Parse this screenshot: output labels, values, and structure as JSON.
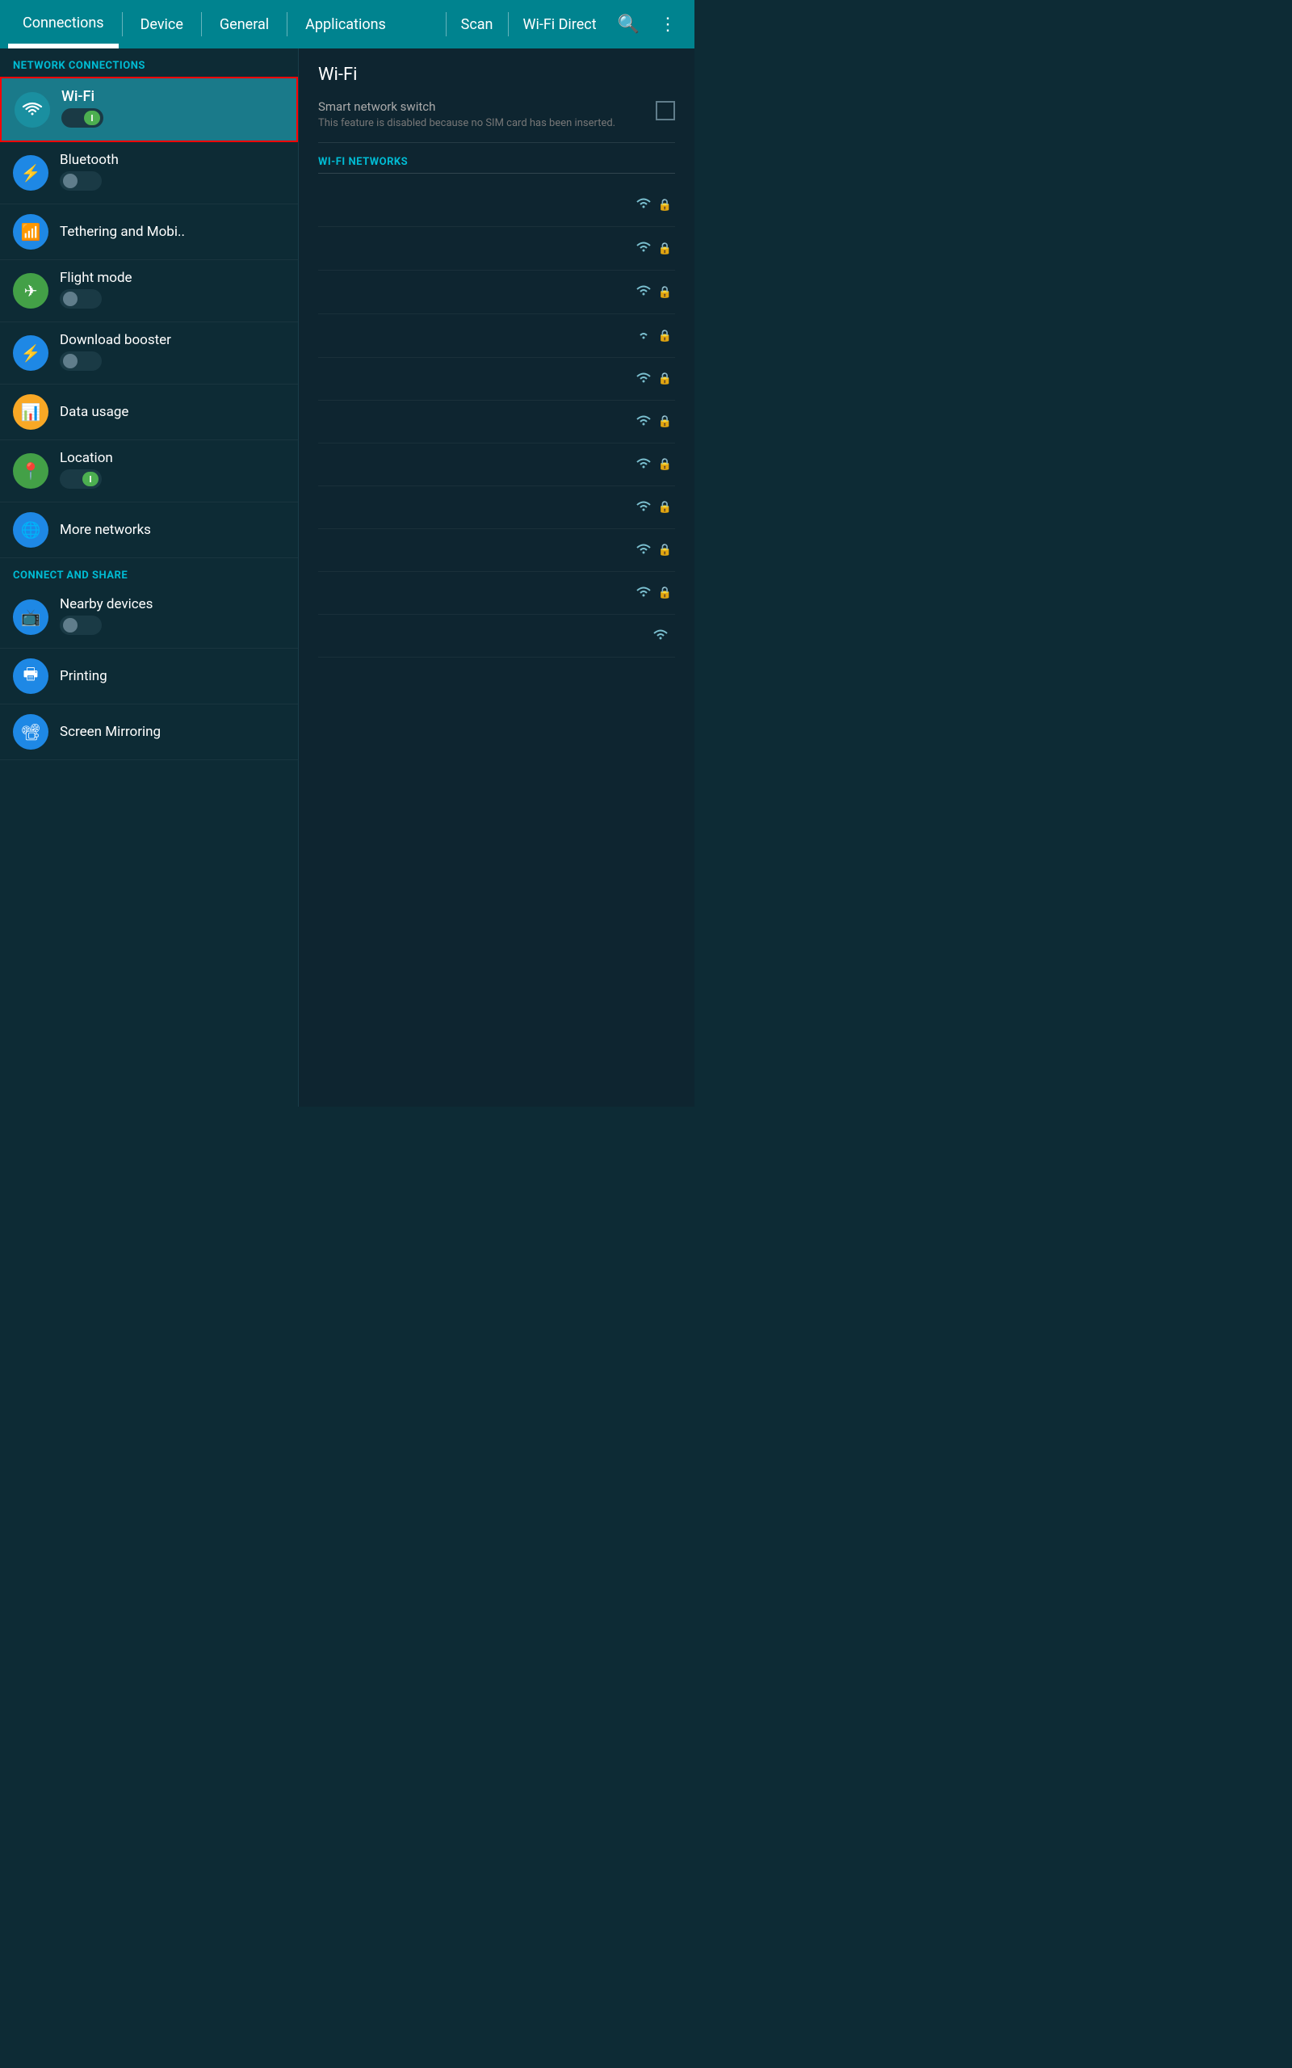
{
  "topNav": {
    "tabs": [
      {
        "label": "Connections",
        "active": true
      },
      {
        "label": "Device",
        "active": false
      },
      {
        "label": "General",
        "active": false
      },
      {
        "label": "Applications",
        "active": false
      }
    ],
    "actions": [
      "Scan",
      "Wi-Fi Direct"
    ],
    "icons": [
      "search",
      "more-vert"
    ]
  },
  "leftPanel": {
    "networkConnectionsLabel": "NETWORK CONNECTIONS",
    "connectAndShareLabel": "CONNECT AND SHARE",
    "items": [
      {
        "id": "wifi",
        "label": "Wi-Fi",
        "icon": "wifi",
        "iconBg": "icon-teal",
        "toggleState": "on",
        "highlighted": true
      },
      {
        "id": "bluetooth",
        "label": "Bluetooth",
        "icon": "bluetooth",
        "iconBg": "icon-blue",
        "toggleState": "off"
      },
      {
        "id": "tethering",
        "label": "Tethering and Mobi..",
        "icon": "hotspot",
        "iconBg": "icon-blue",
        "toggleState": null
      },
      {
        "id": "flightmode",
        "label": "Flight mode",
        "icon": "flight",
        "iconBg": "icon-green",
        "toggleState": "off"
      },
      {
        "id": "downloadbooster",
        "label": "Download booster",
        "icon": "bolt",
        "iconBg": "icon-blue",
        "toggleState": "off"
      },
      {
        "id": "datausage",
        "label": "Data usage",
        "icon": "bar_chart",
        "iconBg": "icon-amber",
        "toggleState": null
      },
      {
        "id": "location",
        "label": "Location",
        "icon": "place",
        "iconBg": "icon-green",
        "toggleState": "on"
      },
      {
        "id": "morenetworks",
        "label": "More networks",
        "icon": "network_wifi",
        "iconBg": "icon-blue",
        "toggleState": null
      }
    ],
    "shareItems": [
      {
        "id": "nearbydevices",
        "label": "Nearby devices",
        "icon": "screen_share",
        "iconBg": "icon-blue",
        "toggleState": "off"
      },
      {
        "id": "printing",
        "label": "Printing",
        "icon": "print",
        "iconBg": "icon-blue",
        "toggleState": null
      },
      {
        "id": "screenmirroring",
        "label": "Screen Mirroring",
        "icon": "cast",
        "iconBg": "icon-blue",
        "toggleState": null
      }
    ]
  },
  "rightPanel": {
    "title": "Wi-Fi",
    "smartSwitch": {
      "label": "Smart network switch",
      "description": "This feature is disabled because no SIM card has been inserted."
    },
    "networksLabel": "WI-FI NETWORKS",
    "networks": [
      {
        "name": "",
        "signal": 3,
        "locked": true
      },
      {
        "name": "",
        "signal": 3,
        "locked": true
      },
      {
        "name": "",
        "signal": 3,
        "locked": true
      },
      {
        "name": "",
        "signal": 2,
        "locked": true
      },
      {
        "name": "",
        "signal": 3,
        "locked": true
      },
      {
        "name": "",
        "signal": 3,
        "locked": true
      },
      {
        "name": "",
        "signal": 3,
        "locked": true
      },
      {
        "name": "",
        "signal": 3,
        "locked": true
      },
      {
        "name": "",
        "signal": 3,
        "locked": true
      },
      {
        "name": "",
        "signal": 3,
        "locked": true
      },
      {
        "name": "",
        "signal": 3,
        "locked": false
      }
    ]
  }
}
